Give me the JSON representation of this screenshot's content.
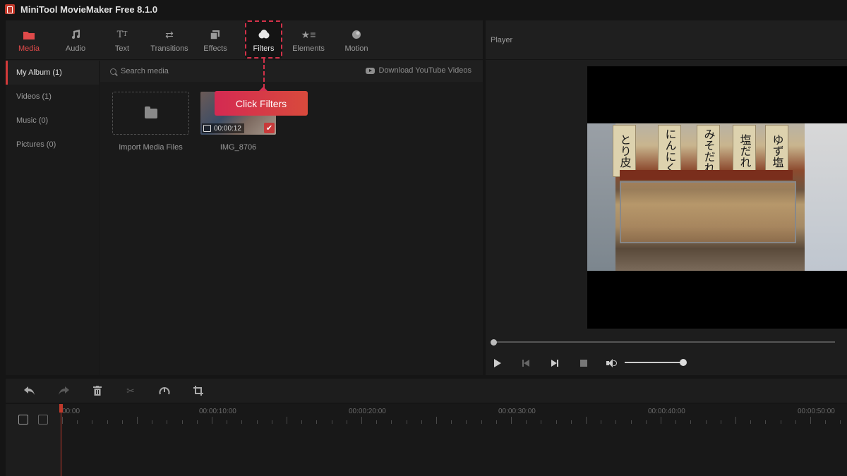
{
  "app": {
    "title": "MiniTool MovieMaker Free 8.1.0"
  },
  "toolbar": {
    "items": [
      {
        "label": "Media",
        "icon": "folder-icon"
      },
      {
        "label": "Audio",
        "icon": "music-note-icon"
      },
      {
        "label": "Text",
        "icon": "text-icon"
      },
      {
        "label": "Transitions",
        "icon": "swap-arrows-icon"
      },
      {
        "label": "Effects",
        "icon": "effects-icon"
      },
      {
        "label": "Filters",
        "icon": "filters-icon"
      },
      {
        "label": "Elements",
        "icon": "elements-icon"
      },
      {
        "label": "Motion",
        "icon": "motion-icon"
      }
    ],
    "active": "Media",
    "highlighted": "Filters"
  },
  "sidebar": {
    "items": [
      {
        "label": "My Album (1)"
      },
      {
        "label": "Videos (1)"
      },
      {
        "label": "Music (0)"
      },
      {
        "label": "Pictures (0)"
      }
    ]
  },
  "search": {
    "placeholder": "Search media",
    "youtube_label": "Download YouTube Videos"
  },
  "media": {
    "import_label": "Import Media Files",
    "clip": {
      "name": "IMG_8706",
      "duration": "00:00:12"
    }
  },
  "callout": {
    "text": "Click Filters"
  },
  "player": {
    "title": "Player"
  },
  "timeline": {
    "ticks": [
      "00:00",
      "00:00:10:00",
      "00:00:20:00",
      "00:00:30:00",
      "00:00:40:00",
      "00:00:50:00"
    ]
  },
  "colors": {
    "accent": "#d23a3a",
    "callout": "#d42a52",
    "background": "#151515"
  }
}
